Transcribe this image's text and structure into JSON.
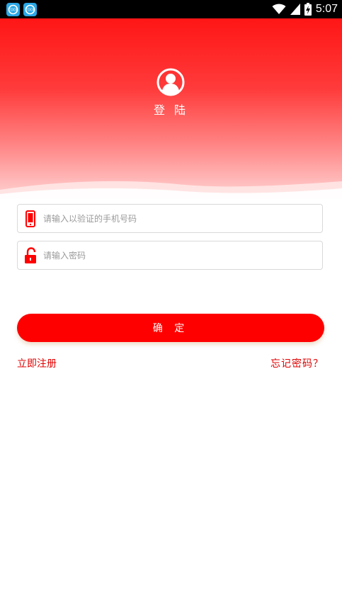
{
  "status_bar": {
    "time": "5:07",
    "icons": [
      "app-icon",
      "app-icon",
      "wifi-icon",
      "signal-icon",
      "battery-charging-icon"
    ]
  },
  "header": {
    "title": "登 陆",
    "avatar_icon": "user-icon"
  },
  "form": {
    "phone": {
      "placeholder": "请输入以验证的手机号码",
      "value": "",
      "icon": "phone-icon"
    },
    "password": {
      "placeholder": "请输入密码",
      "value": "",
      "icon": "unlock-icon"
    },
    "submit_label": "确 定"
  },
  "links": {
    "register": "立即注册",
    "forgot": "忘记密码？"
  },
  "colors": {
    "primary": "#ff0000",
    "link": "#e00000",
    "background": "#ffffff"
  }
}
